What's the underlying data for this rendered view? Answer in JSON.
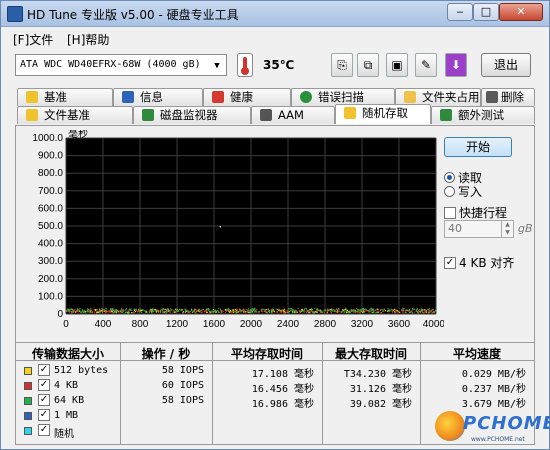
{
  "window": {
    "title": "HD Tune 专业版 v5.00 - 硬盘专业工具",
    "min": "‒",
    "max": "□",
    "close": "✕"
  },
  "menu": [
    {
      "label": "[F]文件"
    },
    {
      "label": "[H]帮助"
    }
  ],
  "toolbar": {
    "drive": "ATA     WDC WD40EFRX-68W (4000 gB)",
    "temperature": "35℃",
    "buttons": [
      {
        "icon": "copy-text-icon",
        "glyph": "⎘"
      },
      {
        "icon": "copy-screenshot-icon",
        "glyph": "⧉"
      },
      {
        "icon": "save-icon",
        "glyph": "▣"
      },
      {
        "icon": "options-icon",
        "glyph": "✎"
      },
      {
        "icon": "download-icon",
        "glyph": "⬇"
      }
    ],
    "exit": "退出"
  },
  "tabs_top": [
    {
      "label": "基准",
      "icon": "lightbulb-icon",
      "color": "#f2c12e"
    },
    {
      "label": "信息",
      "icon": "info-icon",
      "color": "#2b64b8"
    },
    {
      "label": "健康",
      "icon": "health-cross-icon",
      "color": "#d43a2f"
    },
    {
      "label": "错误扫描",
      "icon": "magnifier-icon",
      "color": "#2c8f3a"
    },
    {
      "label": "文件夹占用率",
      "icon": "folder-icon",
      "color": "#f0c14b"
    },
    {
      "label": "删除",
      "icon": "trash-icon",
      "color": "#5a5a5a"
    }
  ],
  "tabs_bottom": [
    {
      "label": "文件基准",
      "icon": "file-benchmark-icon",
      "color": "#f2c12e"
    },
    {
      "label": "磁盘监视器",
      "icon": "monitor-icon",
      "color": "#2f8a3e"
    },
    {
      "label": "AAM",
      "icon": "speaker-icon",
      "color": "#555555"
    },
    {
      "label": "随机存取",
      "icon": "random-access-icon",
      "color": "#f2c12e",
      "active": true
    },
    {
      "label": "额外测试",
      "icon": "extra-tests-icon",
      "color": "#2f8a3e"
    }
  ],
  "controls": {
    "start": "开始",
    "read": "读取",
    "write": "写入",
    "short_stroke": "快捷行程",
    "stroke_value": "40",
    "stroke_unit": "gB",
    "align": "4 KB 对齐"
  },
  "chart_data": {
    "type": "scatter",
    "ylabel": "毫秒",
    "xunit": "gB",
    "xlim": [
      0,
      4000
    ],
    "ylim": [
      0,
      1000
    ],
    "xticks": [
      0,
      400,
      800,
      1200,
      1600,
      2000,
      2400,
      2800,
      3200,
      3600,
      4000
    ],
    "yticks": [
      0,
      100,
      200,
      300,
      400,
      500,
      600,
      700,
      800,
      900,
      1000
    ],
    "ytick_labels": [
      "0",
      "100.0",
      "200.0",
      "300.0",
      "400.0",
      "500.0",
      "600.0",
      "700.0",
      "800.0",
      "900.0",
      "1000.0"
    ],
    "xtick_labels": [
      "0",
      "400",
      "800",
      "1200",
      "1600",
      "2000",
      "2400",
      "2800",
      "3200",
      "3600",
      "4000gB"
    ],
    "grid": true,
    "background": "#000000",
    "series": [
      {
        "name": "512 bytes",
        "color": "#f2d21e",
        "band": [
          5,
          25
        ]
      },
      {
        "name": "4 KB",
        "color": "#d03030",
        "band": [
          5,
          25
        ]
      },
      {
        "name": "64 KB",
        "color": "#22b14c",
        "band": [
          5,
          30
        ]
      },
      {
        "name": "1 MB",
        "color": "#2f5fbf",
        "band": [
          0,
          0
        ]
      },
      {
        "name": "随机",
        "color": "#2ed3e6",
        "band": [
          0,
          0
        ]
      }
    ],
    "outlier": {
      "x": 1660,
      "y": 500
    }
  },
  "table": {
    "headers": [
      "传输数据大小",
      "操作 / 秒",
      "平均存取时间",
      "最大存取时间",
      "平均速度"
    ],
    "rows": [
      {
        "label": "512 bytes",
        "color": "#f2d21e",
        "ops": "58 IOPS",
        "avg": "17.108 毫秒",
        "max": "T34.230 毫秒",
        "speed": "0.029 MB/秒"
      },
      {
        "label": "4 KB",
        "color": "#d03030",
        "ops": "60 IOPS",
        "avg": "16.456 毫秒",
        "max": "31.126 毫秒",
        "speed": "0.237 MB/秒"
      },
      {
        "label": "64 KB",
        "color": "#22b14c",
        "ops": "58 IOPS",
        "avg": "16.986 毫秒",
        "max": "39.082 毫秒",
        "speed": "3.679 MB/秒"
      },
      {
        "label": "1 MB",
        "color": "#2f5fbf",
        "ops": "",
        "avg": "",
        "max": "",
        "speed": ""
      },
      {
        "label": "随机",
        "color": "#2ed3e6",
        "ops": "",
        "avg": "",
        "max": "",
        "speed": ""
      }
    ]
  },
  "watermark": {
    "text": "PCHOME",
    "sub": "www.PCHOME.net"
  }
}
